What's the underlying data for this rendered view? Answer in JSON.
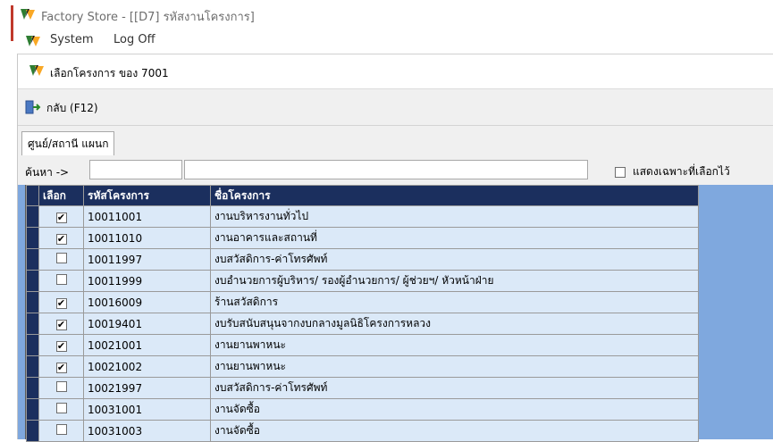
{
  "window": {
    "title": "Factory Store - [[D7] รหัสงานโครงการ]",
    "menu": [
      "System",
      "Log Off"
    ]
  },
  "dialog": {
    "title": "เลือกโครงการ ของ 7001",
    "back_button": "กลับ (F12)",
    "tab": "ศูนย์/สถานี แผนก",
    "search": {
      "label": "ค้นหา ->",
      "code_value": "",
      "name_value": "",
      "show_selected_label": "แสดงเฉพาะที่เลือกไว้",
      "show_selected_checked": false
    },
    "grid": {
      "columns": [
        "เลือก",
        "รหัสโครงการ",
        "ชื่อโครงการ"
      ],
      "rows": [
        {
          "checked": "✔",
          "code": "10011001",
          "name": "งานบริหารงานทั่วไป"
        },
        {
          "checked": "✔",
          "code": "10011010",
          "name": "งานอาคารและสถานที่"
        },
        {
          "checked": "",
          "code": "10011997",
          "name": "งบสวัสดิการ-ค่าโทรศัพท์"
        },
        {
          "checked": "",
          "code": "10011999",
          "name": "งบอำนวยการผู้บริหาร/ รองผู้อำนวยการ/ ผู้ช่วยฯ/ หัวหน้าฝ่าย"
        },
        {
          "checked": "✔",
          "code": "10016009",
          "name": "ร้านสวัสดิการ"
        },
        {
          "checked": "✔",
          "code": "10019401",
          "name": "งบรับสนับสนุนจากงบกลางมูลนิธิโครงการหลวง"
        },
        {
          "checked": "✔",
          "code": "10021001",
          "name": "งานยานพาหนะ"
        },
        {
          "checked": "✔",
          "code": "10021002",
          "name": "งานยานพาหนะ"
        },
        {
          "checked": "",
          "code": "10021997",
          "name": "งบสวัสดิการ-ค่าโทรศัพท์"
        },
        {
          "checked": "",
          "code": "10031001",
          "name": "งานจัดซื้อ"
        },
        {
          "checked": "",
          "code": "10031003",
          "name": "งานจัดซื้อ"
        }
      ]
    }
  },
  "colors": {
    "grid_header": "#1b2f5e",
    "grid_row": "#dbe9f8",
    "grid_background": "#7fa8de",
    "window_accent": "#c0392b"
  }
}
